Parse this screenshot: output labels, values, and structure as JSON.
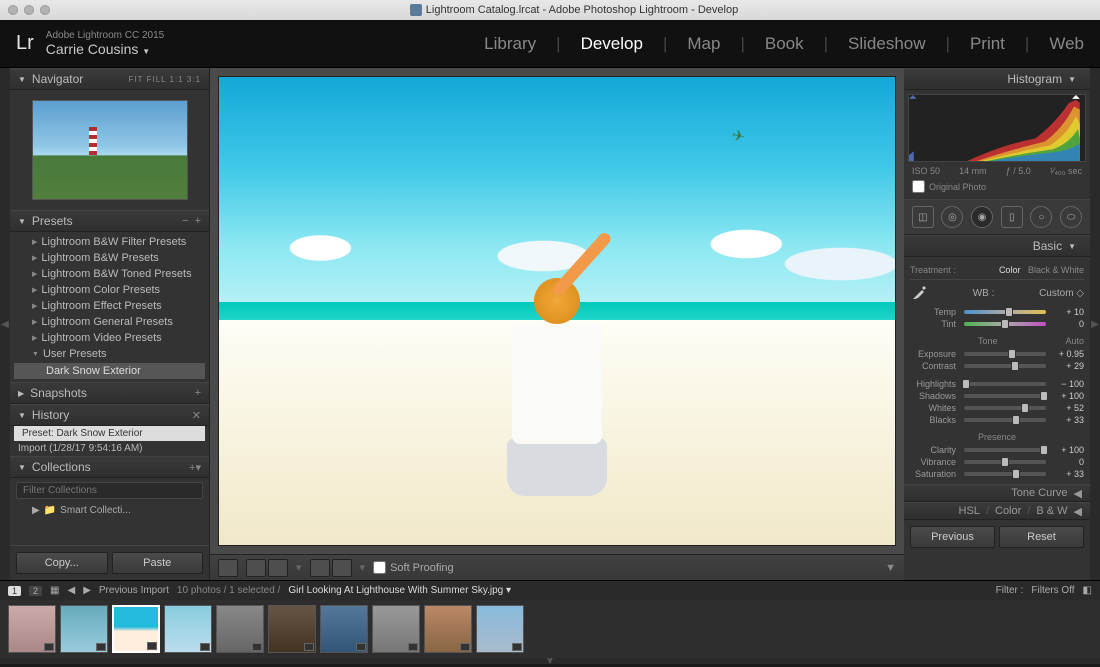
{
  "titlebar": {
    "title": "Lightroom Catalog.lrcat - Adobe Photoshop Lightroom - Develop"
  },
  "header": {
    "app_version": "Adobe Lightroom CC 2015",
    "user_name": "Carrie Cousins",
    "modules": [
      "Library",
      "Develop",
      "Map",
      "Book",
      "Slideshow",
      "Print",
      "Web"
    ],
    "active_module": "Develop"
  },
  "navigator": {
    "title": "Navigator",
    "modes": "FIT   FILL   1:1   3:1"
  },
  "presets": {
    "title": "Presets",
    "items": [
      "Lightroom B&W Filter Presets",
      "Lightroom B&W Presets",
      "Lightroom B&W Toned Presets",
      "Lightroom Color Presets",
      "Lightroom Effect Presets",
      "Lightroom General Presets",
      "Lightroom Video Presets",
      "User Presets"
    ],
    "selected": "Dark Snow Exterior"
  },
  "snapshots": {
    "title": "Snapshots"
  },
  "history": {
    "title": "History",
    "items": [
      {
        "label": "Preset: Dark Snow Exterior",
        "selected": true
      },
      {
        "label": "Import (1/28/17 9:54:16 AM)",
        "selected": false
      }
    ]
  },
  "collections": {
    "title": "Collections",
    "search_placeholder": "Filter Collections",
    "item": "Smart Collecti..."
  },
  "copy_paste": {
    "copy": "Copy...",
    "paste": "Paste"
  },
  "toolbar": {
    "soft_proofing": "Soft Proofing"
  },
  "histogram": {
    "title": "Histogram",
    "iso": "ISO 50",
    "focal": "14 mm",
    "aperture": "ƒ / 5.0",
    "shutter": "¹⁄₄₀₀ sec",
    "original": "Original Photo"
  },
  "basic": {
    "title": "Basic",
    "treatment_label": "Treatment :",
    "treatment_color": "Color",
    "treatment_bw": "Black & White",
    "wb_label": "WB :",
    "wb_value": "Custom",
    "tone_label": "Tone",
    "auto": "Auto",
    "presence_label": "Presence",
    "sliders": {
      "temp": {
        "label": "Temp",
        "value": "+ 10",
        "pos": 55
      },
      "tint": {
        "label": "Tint",
        "value": "0",
        "pos": 50
      },
      "exposure": {
        "label": "Exposure",
        "value": "+ 0.95",
        "pos": 58
      },
      "contrast": {
        "label": "Contrast",
        "value": "+ 29",
        "pos": 62
      },
      "highlights": {
        "label": "Highlights",
        "value": "− 100",
        "pos": 2
      },
      "shadows": {
        "label": "Shadows",
        "value": "+ 100",
        "pos": 98
      },
      "whites": {
        "label": "Whites",
        "value": "+ 52",
        "pos": 74
      },
      "blacks": {
        "label": "Blacks",
        "value": "+ 33",
        "pos": 64
      },
      "clarity": {
        "label": "Clarity",
        "value": "+ 100",
        "pos": 98
      },
      "vibrance": {
        "label": "Vibrance",
        "value": "0",
        "pos": 50
      },
      "saturation": {
        "label": "Saturation",
        "value": "+ 33",
        "pos": 64
      }
    }
  },
  "subpanels": {
    "tone_curve": "Tone Curve",
    "hsl": "HSL",
    "color": "Color",
    "bw": "B & W"
  },
  "prev_reset": {
    "previous": "Previous",
    "reset": "Reset"
  },
  "filmstrip": {
    "badge1": "1",
    "badge2": "2",
    "source": "Previous Import",
    "count": "10 photos / 1 selected /",
    "filename": "Girl Looking At Lighthouse With Summer Sky.jpg",
    "filter_label": "Filter :",
    "filter_value": "Filters Off"
  }
}
